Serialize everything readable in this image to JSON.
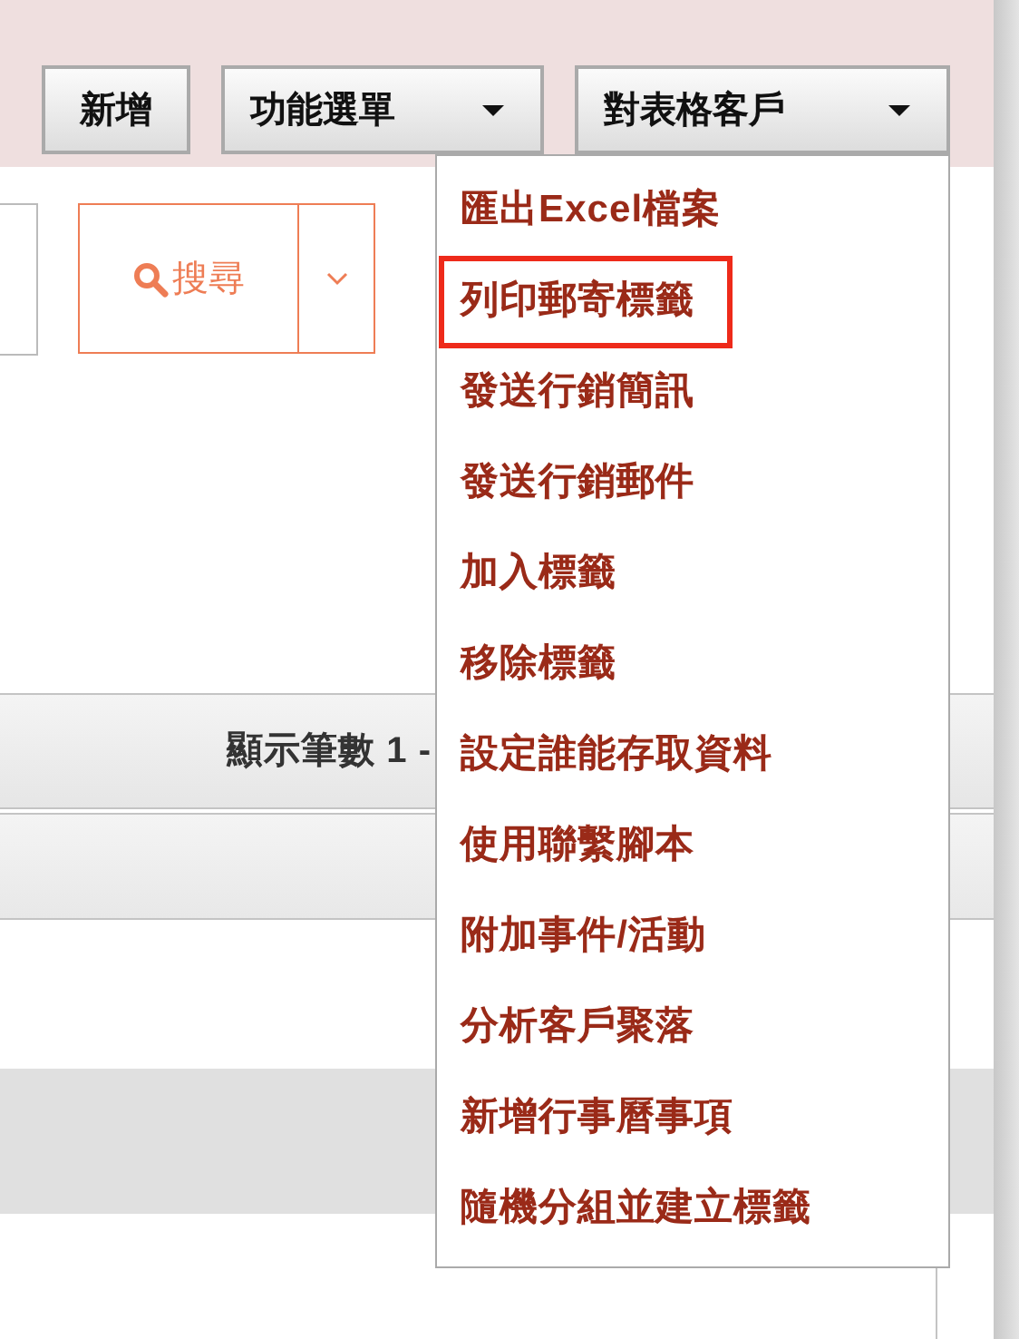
{
  "toolbar": {
    "buttons": [
      {
        "label": "新增",
        "kind": "plain"
      },
      {
        "label": "功能選單",
        "kind": "dropdown"
      },
      {
        "label": "對表格客戶",
        "kind": "dropdown"
      }
    ]
  },
  "search": {
    "button": "搜尋"
  },
  "pager": {
    "text": "顯示筆數 1 -"
  },
  "menu": {
    "items": [
      {
        "label": "匯出Excel檔案",
        "selected": false
      },
      {
        "label": "列印郵寄標籤",
        "selected": true
      },
      {
        "label": "發送行銷簡訊",
        "selected": false
      },
      {
        "label": "發送行銷郵件",
        "selected": false
      },
      {
        "label": "加入標籤",
        "selected": false
      },
      {
        "label": "移除標籤",
        "selected": false
      },
      {
        "label": "設定誰能存取資料",
        "selected": false
      },
      {
        "label": "使用聯繫腳本",
        "selected": false
      },
      {
        "label": "附加事件/活動",
        "selected": false
      },
      {
        "label": "分析客戶聚落",
        "selected": false
      },
      {
        "label": "新增行事曆事項",
        "selected": false
      },
      {
        "label": "隨機分組並建立標籤",
        "selected": false
      }
    ]
  }
}
